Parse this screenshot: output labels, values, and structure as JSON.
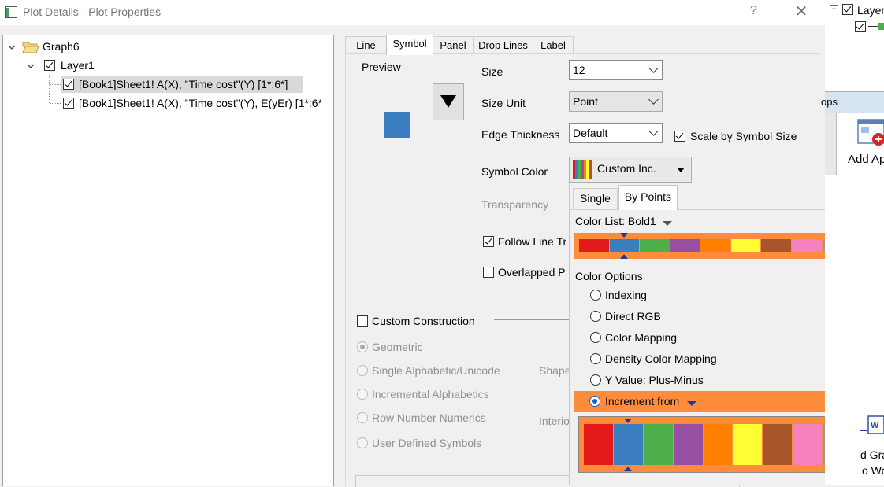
{
  "window": {
    "title": "Plot Details - Plot Properties",
    "help": "?",
    "close": "✕"
  },
  "tree": {
    "graph": "Graph6",
    "layer": "Layer1",
    "plots": [
      "[Book1]Sheet1! A(X), \"Time cost\"(Y) [1*:6*]",
      "[Book1]Sheet1! A(X), \"Time cost\"(Y), E(yEr) [1*:6*"
    ]
  },
  "tabs": [
    "Line",
    "Symbol",
    "Panel",
    "Drop Lines",
    "Label"
  ],
  "symbol": {
    "preview_label": "Preview",
    "size_label": "Size",
    "size_value": "12",
    "size_unit_label": "Size Unit",
    "size_unit_value": "Point",
    "edge_label": "Edge Thickness",
    "edge_value": "Default",
    "scale_label": "Scale by Symbol Size",
    "color_label": "Symbol Color",
    "color_value": "Custom Inc.",
    "transparency_label": "Transparency",
    "follow_label": "Follow Line Tr",
    "overlapped_label": "Overlapped P",
    "custom_label": "Custom Construction",
    "shape_label": "Shape",
    "interior_label": "Interio",
    "construction_options": [
      "Geometric",
      "Single Alphabetic/Unicode",
      "Incremental Alphabetics",
      "Row Number Numerics",
      "User Defined Symbols"
    ],
    "preview_color": "#3a7ebf"
  },
  "popup": {
    "tabs": [
      "Single",
      "By Points"
    ],
    "color_list_label": "Color List: Bold1",
    "color_options_label": "Color Options",
    "options": [
      "Indexing",
      "Direct RGB",
      "Color Mapping",
      "Density Color Mapping",
      "Y Value: Plus-Minus",
      "Increment from"
    ],
    "colors": [
      "#e31a1c",
      "#3a7ebf",
      "#4daf4a",
      "#984ea3",
      "#ff7f00",
      "#ffff33",
      "#a65628",
      "#f781bf",
      "#999999"
    ],
    "highlight_color": "#ff8c3c"
  },
  "right_window": {
    "layer_label": "Layer",
    "tab_label": "ops",
    "add_label": "Add Ap",
    "side_labels": [
      "d Gra",
      "o Wo"
    ]
  }
}
